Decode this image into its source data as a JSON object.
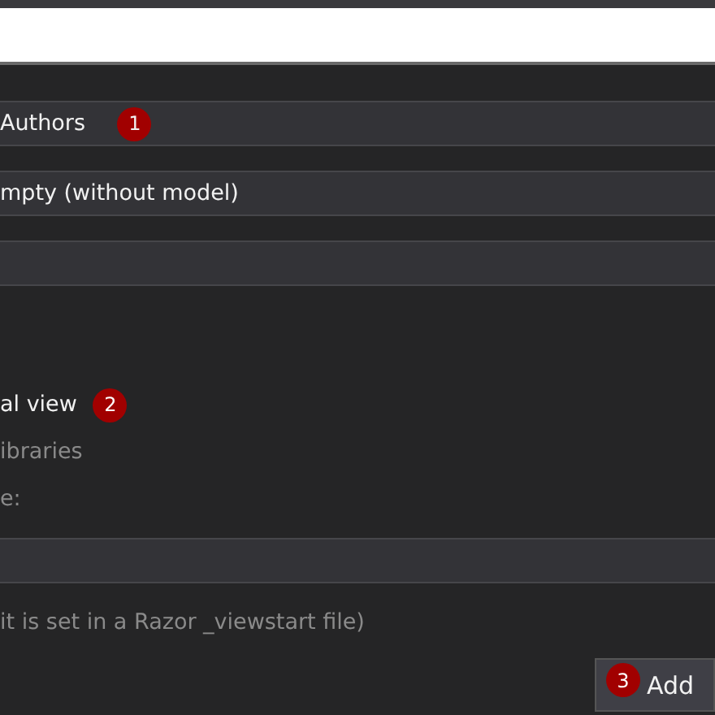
{
  "fields": [
    {
      "kind": "text",
      "value": "Authors",
      "badge": "1"
    },
    {
      "kind": "text",
      "value": "mpty (without model)"
    },
    {
      "kind": "text"
    }
  ],
  "options": [
    {
      "label": "al view",
      "disabled": false,
      "badge": "2"
    },
    {
      "label": "ibraries",
      "disabled": true
    }
  ],
  "layout": {
    "label": "e:",
    "disabled": true,
    "hint": "it is set in a Razor _viewstart file)"
  },
  "button": {
    "label": "Add",
    "badge": "3"
  }
}
